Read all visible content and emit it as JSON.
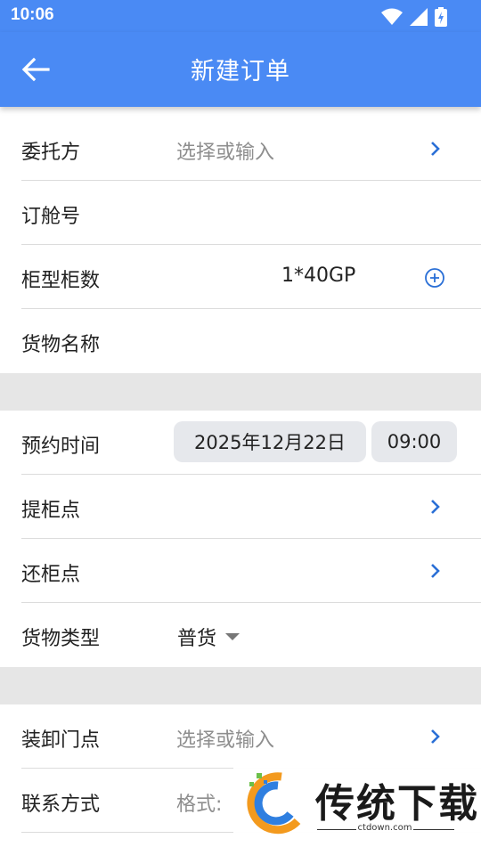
{
  "status_bar": {
    "time": "10:06"
  },
  "app_bar": {
    "title": "新建订单"
  },
  "section1": {
    "client": {
      "label": "委托方",
      "placeholder": "选择或输入"
    },
    "booking_no": {
      "label": "订舱号"
    },
    "container": {
      "label": "柜型柜数",
      "value": "1*40GP"
    },
    "goods_name": {
      "label": "货物名称"
    }
  },
  "section2": {
    "appointment": {
      "label": "预约时间",
      "date": "2025年12月22日",
      "time": "09:00"
    },
    "pickup": {
      "label": "提柜点"
    },
    "return": {
      "label": "还柜点"
    },
    "goods_type": {
      "label": "货物类型",
      "value": "普货"
    }
  },
  "section3": {
    "loading_point": {
      "label": "装卸门点",
      "placeholder": "选择或输入"
    },
    "contact": {
      "label": "联系方式",
      "placeholder": "格式:"
    }
  },
  "watermark": {
    "brand": "传统下载",
    "url": "ctdown.com"
  },
  "colors": {
    "primary": "#4a8af4",
    "link_blue": "#2a6fd6",
    "divider": "#e6e6e6"
  }
}
